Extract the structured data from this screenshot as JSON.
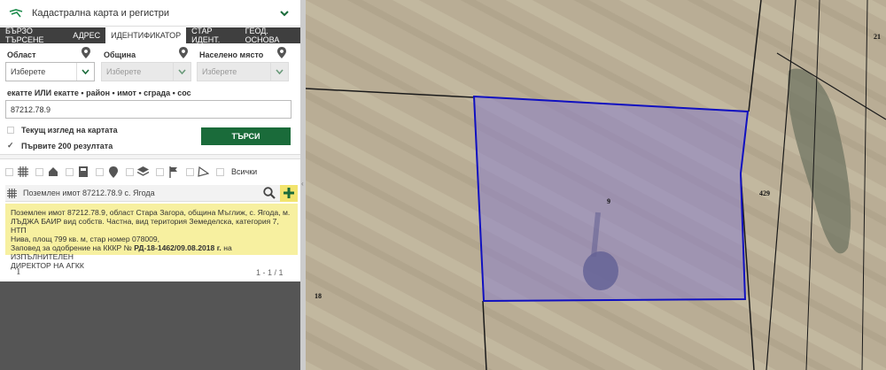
{
  "header": {
    "title": "Кадастрална карта и регистри"
  },
  "tabs": [
    {
      "label": "БЪРЗО ТЪРСЕНЕ",
      "active": false
    },
    {
      "label": "АДРЕС",
      "active": false
    },
    {
      "label": "ИДЕНТИФИКАТОР",
      "active": true
    },
    {
      "label": "СТАР ИДЕНТ.",
      "active": false
    },
    {
      "label": "ГЕОД. ОСНОВА",
      "active": false
    }
  ],
  "fields": {
    "oblast": {
      "label": "Област",
      "value": "Изберете"
    },
    "obshtina": {
      "label": "Община",
      "value": "Изберете"
    },
    "naseleno": {
      "label": "Населено място",
      "value": "Изберете"
    }
  },
  "search": {
    "hint": "екатте ИЛИ екатте • район • имот • сграда • сос",
    "value": "87212.78.9",
    "button": "ТЪРСИ"
  },
  "options": {
    "current_view": "Текущ изглед на картата",
    "first_200": "Първите 200 резултата",
    "first_200_checked": true
  },
  "filters": {
    "all_label": "Всички"
  },
  "result": {
    "header": "Поземлен имот 87212.78.9 с. Ягода",
    "line1": "Поземлен имот 87212.78.9, област Стара Загора, община Мъглиж, с. Ягода, м.",
    "line2": "ЛЪДЖА БАИР вид собств. Частна, вид територия Земеделска, категория 7, НТП",
    "line3": "Нива, площ 799 кв. м, стар номер 078009,",
    "line4_prefix": "Заповед за одобрение на КККР №",
    "line4_order": "РД-18-1462/09.08.2018 г.",
    "line4_suffix": "на ИЗПЪЛНИТЕЛЕН",
    "line5": "ДИРЕКТОР НА АГКК"
  },
  "pager": {
    "current": "1",
    "range": "1 - 1 / 1"
  },
  "map": {
    "labels": {
      "parcel": "9",
      "n429": "429",
      "n18": "18",
      "n21": "21"
    },
    "colors": {
      "parcel_fill": "#8a7fc9",
      "parcel_stroke": "#1010c0",
      "ground": "#b8ab93"
    }
  }
}
